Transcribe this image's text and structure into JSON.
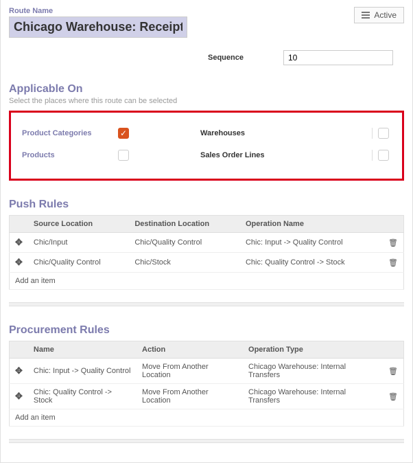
{
  "route_name_label": "Route Name",
  "route_name_value": "Chicago Warehouse: Receipt in",
  "active_label": "Active",
  "sequence_label": "Sequence",
  "sequence_value": "10",
  "applicable": {
    "title": "Applicable On",
    "help": "Select the places where this route can be selected",
    "product_categories_label": "Product Categories",
    "products_label": "Products",
    "warehouses_label": "Warehouses",
    "sales_lines_label": "Sales Order Lines"
  },
  "push": {
    "title": "Push Rules",
    "columns": {
      "source": "Source Location",
      "destination": "Destination Location",
      "operation": "Operation Name"
    },
    "rows": [
      {
        "source": "Chic/Input",
        "destination": "Chic/Quality Control",
        "operation": "Chic: Input -> Quality Control"
      },
      {
        "source": "Chic/Quality Control",
        "destination": "Chic/Stock",
        "operation": "Chic: Quality Control -> Stock"
      }
    ],
    "add_label": "Add an item"
  },
  "procurement": {
    "title": "Procurement Rules",
    "columns": {
      "name": "Name",
      "action": "Action",
      "operation": "Operation Type"
    },
    "rows": [
      {
        "name": "Chic: Input -> Quality Control",
        "action": "Move From Another Location",
        "operation": "Chicago Warehouse: Internal Transfers"
      },
      {
        "name": "Chic: Quality Control -> Stock",
        "action": "Move From Another Location",
        "operation": "Chicago Warehouse: Internal Transfers"
      }
    ],
    "add_label": "Add an item"
  }
}
